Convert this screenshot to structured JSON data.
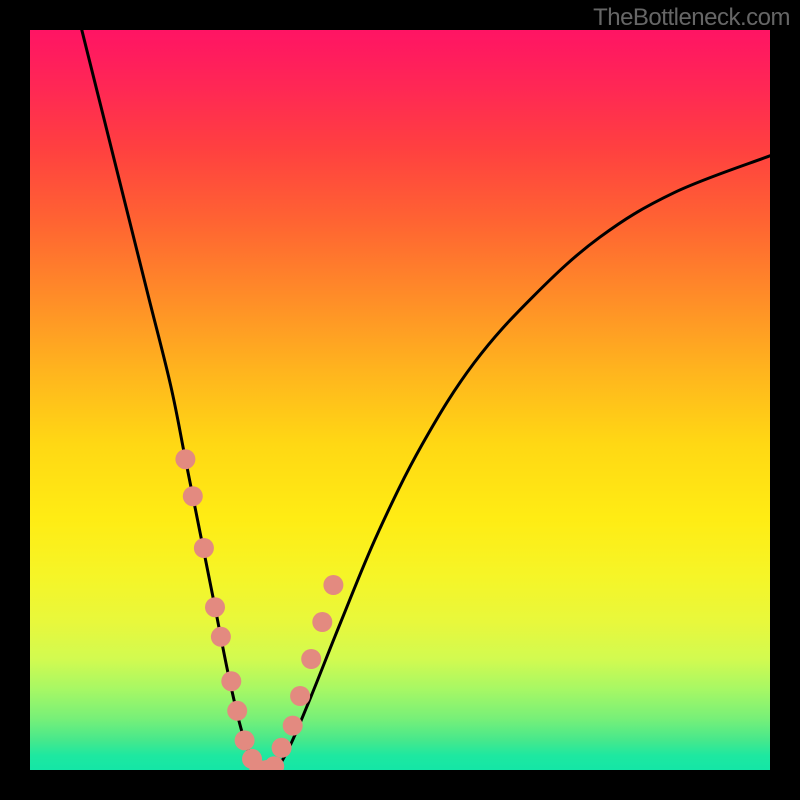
{
  "attribution": "TheBottleneck.com",
  "chart_data": {
    "type": "line",
    "title": "",
    "xlabel": "",
    "ylabel": "",
    "xlim": [
      0,
      100
    ],
    "ylim": [
      0,
      100
    ],
    "series": [
      {
        "name": "bottleneck-curve",
        "x": [
          7,
          10,
          13,
          16,
          19,
          21,
          23,
          25,
          27,
          29,
          31,
          33,
          35,
          38,
          42,
          47,
          53,
          60,
          68,
          77,
          87,
          100
        ],
        "y": [
          100,
          88,
          76,
          64,
          52,
          42,
          32,
          22,
          12,
          4,
          0,
          0,
          3,
          10,
          20,
          32,
          44,
          55,
          64,
          72,
          78,
          83
        ]
      }
    ],
    "markers": {
      "name": "salmon-dots",
      "color": "#e38a80",
      "x": [
        21.0,
        22.0,
        23.5,
        25.0,
        25.8,
        27.2,
        28.0,
        29.0,
        30.0,
        31.0,
        32.0,
        33.0,
        34.0,
        35.5,
        36.5,
        38.0,
        39.5,
        41.0
      ],
      "y": [
        42.0,
        37.0,
        30.0,
        22.0,
        18.0,
        12.0,
        8.0,
        4.0,
        1.5,
        0.0,
        0.0,
        0.5,
        3.0,
        6.0,
        10.0,
        15.0,
        20.0,
        25.0
      ]
    },
    "background_gradient": {
      "top": "#ff1464",
      "bottom": "#14e6a6"
    }
  }
}
